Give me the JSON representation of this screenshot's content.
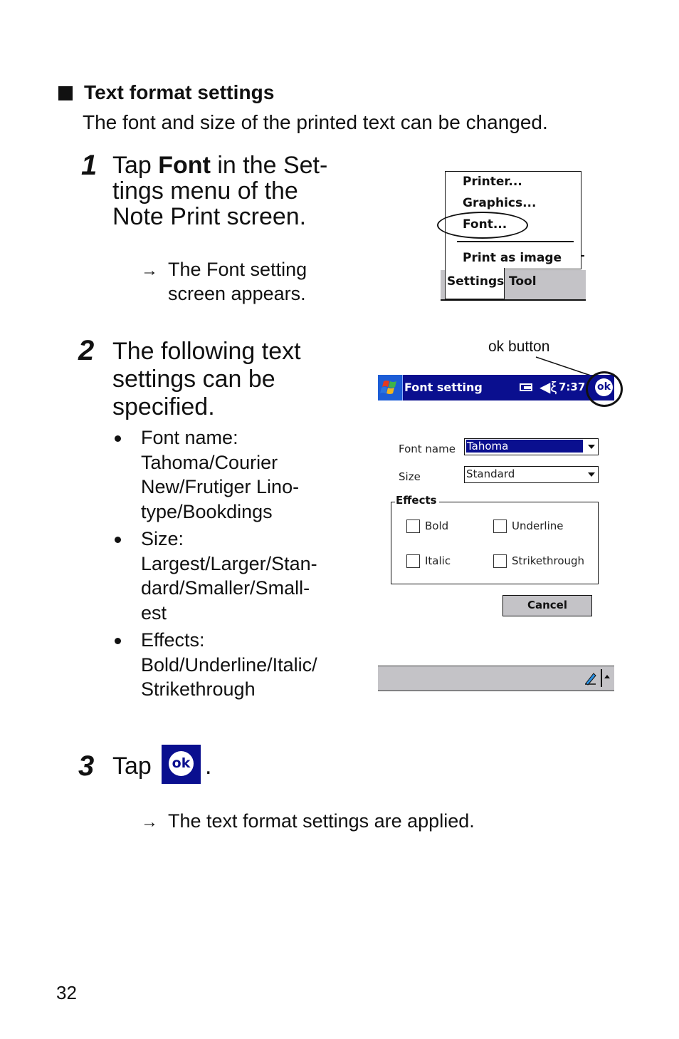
{
  "section": {
    "title": "Text format settings",
    "intro": "The font and size of the printed text can be changed."
  },
  "step1": {
    "number": "1",
    "text_prefix": "Tap ",
    "text_bold": "Font",
    "text_line1_suffix": " in the Set-",
    "text_line2": "tings menu of the",
    "text_line3": "Note Print screen.",
    "result_arrow": "→",
    "result_line1": "The Font setting",
    "result_line2": "screen appears.",
    "menu_screenshot": {
      "items": [
        "Printer...",
        "Graphics...",
        "Font...",
        "Print as image"
      ],
      "highlighted_item": "Font...",
      "menubar": [
        "Settings",
        "Tool"
      ]
    }
  },
  "step2": {
    "number": "2",
    "text_lines": [
      "The following text",
      "settings can be",
      "specified."
    ],
    "bullets": [
      {
        "lines": [
          "Font name:",
          "Tahoma/Courier",
          "New/Frutiger Lino-",
          "type/Bookdings"
        ]
      },
      {
        "lines": [
          "Size:",
          "Largest/Larger/Stan-",
          "dard/Smaller/Small-",
          "est"
        ]
      },
      {
        "lines": [
          "Effects:",
          "Bold/Underline/Italic/",
          "Strikethrough"
        ]
      }
    ],
    "device_screenshot": {
      "callout": "ok button",
      "titlebar": {
        "title": "Font setting",
        "time": "7:37",
        "ok": "ok",
        "icons": [
          "windows-start-icon",
          "battery-icon",
          "speaker-icon"
        ]
      },
      "font_name_label": "Font name",
      "font_name_value": "Tahoma",
      "size_label": "Size",
      "size_value": "Standard",
      "effects_label": "Effects",
      "effects": [
        {
          "label": "Bold",
          "checked": false
        },
        {
          "label": "Underline",
          "checked": false
        },
        {
          "label": "Italic",
          "checked": false
        },
        {
          "label": "Strikethrough",
          "checked": false
        }
      ],
      "cancel_label": "Cancel",
      "colors": {
        "titlebar": "#0a0f8f",
        "menubar": "#c4c3c7",
        "selection": "#0a0f8f"
      }
    }
  },
  "step3": {
    "number": "3",
    "text": "Tap",
    "ok_icon_label": "ok",
    "period": ".",
    "result_arrow": "→",
    "result": "The text format settings are applied."
  },
  "page_number": "32"
}
